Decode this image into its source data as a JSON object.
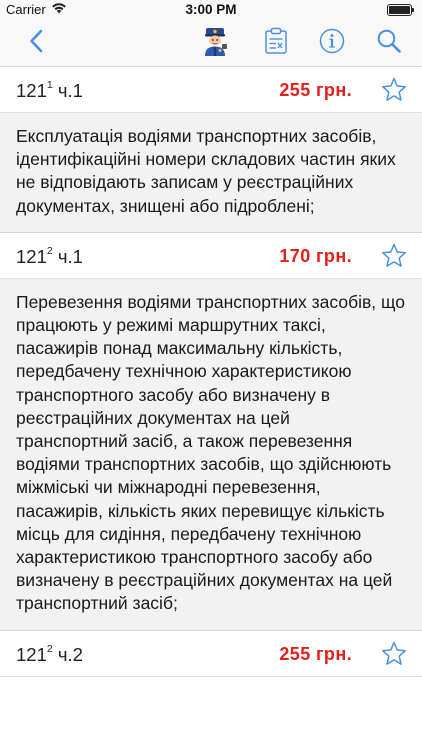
{
  "status_bar": {
    "carrier": "Carrier",
    "time": "3:00 PM",
    "battery_level": 1.0
  },
  "nav_bar": {
    "icons": [
      "back-chevron-icon",
      "police-officer-icon",
      "checklist-icon",
      "info-icon",
      "search-icon"
    ],
    "tint_color": "#4a90e2"
  },
  "items": [
    {
      "article_base": "121",
      "article_sup": "1",
      "article_part": " ч.1",
      "fine": "255 грн.",
      "description": "Експлуатація водіями транспортних засобів, ідентифікаційні номери складових частин яких не відповідають записам у реєстраційних документах, знищені або підроблені;"
    },
    {
      "article_base": "121",
      "article_sup": "2",
      "article_part": " ч.1",
      "fine": "170 грн.",
      "description": "Перевезення водіями транспортних засобів, що працюють у режимі маршрутних таксі, пасажирів понад максимальну кількість, передбачену технічною характеристикою транспортного засобу або визначену в реєстраційних документах на цей транспортний засіб, а також перевезення водіями транспортних засобів, що здійснюють міжміські чи міжнародні перевезення, пасажирів, кількість яких перевищує кількість місць для сидіння, передбачену технічною характеристикою транспортного засобу або визначену в реєстраційних документах на цей транспортний засіб;"
    },
    {
      "article_base": "121",
      "article_sup": "2",
      "article_part": " ч.2",
      "fine": "255 грн."
    }
  ],
  "colors": {
    "fine": "#e3201b",
    "star_outline": "#4a90e2",
    "bar_background": "#f8f8f8",
    "body_background": "#f2f2f2"
  }
}
